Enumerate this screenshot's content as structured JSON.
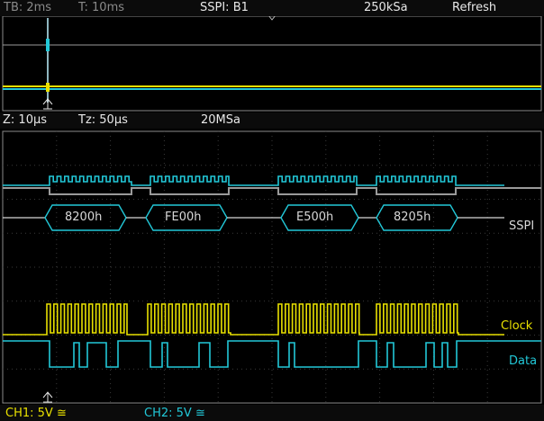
{
  "top_bar": {
    "timebase": "TB: 2ms",
    "trigger_time": "T: 10ms",
    "bus": "SSPI: B1",
    "sample_rate": "250kSa",
    "mode": "Refresh"
  },
  "zoom_bar": {
    "zoom": "Z: 10µs",
    "zoom_position": "Tz: 50µs",
    "sample_rate": "20MSa"
  },
  "bus_decode": {
    "frames": [
      "8200h",
      "FE00h",
      "E500h",
      "8205h"
    ],
    "bus_label": "SSPI"
  },
  "channels": {
    "clock_label": "Clock",
    "data_label": "Data",
    "ch1": "CH1: 5V",
    "ch2": "CH2: 5V",
    "ch1_symbol": "≅",
    "ch2_symbol": "≅"
  },
  "colors": {
    "clock": "#e8e000",
    "data": "#22c8d8",
    "bus": "#22c8d8",
    "grid": "#5a5a5a"
  }
}
